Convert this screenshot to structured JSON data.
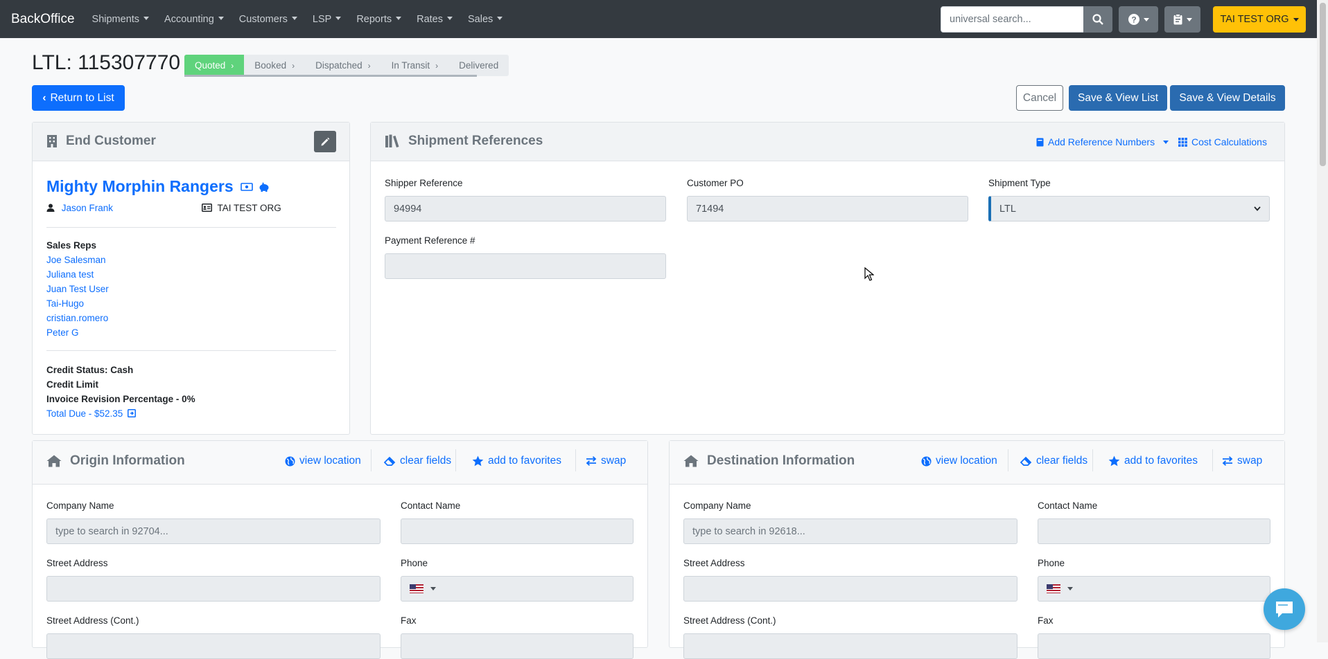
{
  "nav": {
    "brand": "BackOffice",
    "items": [
      "Shipments",
      "Accounting",
      "Customers",
      "LSP",
      "Reports",
      "Rates",
      "Sales"
    ],
    "search_placeholder": "universal search...",
    "org": "TAI TEST ORG"
  },
  "page": {
    "title": "LTL: 115307770",
    "steps": [
      "Quoted",
      "Booked",
      "Dispatched",
      "In Transit",
      "Delivered"
    ],
    "return_label": "Return to List",
    "cancel_label": "Cancel",
    "save_list_label": "Save & View List",
    "save_details_label": "Save & View Details"
  },
  "end_customer": {
    "header": "End Customer",
    "company": "Mighty Morphin Rangers",
    "contact": "Jason Frank",
    "org": "TAI TEST ORG",
    "sales_reps_label": "Sales Reps",
    "sales_reps": [
      "Joe Salesman",
      "Juliana test",
      "Juan Test User",
      "Tai-Hugo",
      "cristian.romero",
      "Peter G"
    ],
    "credit_status": "Credit Status: Cash",
    "credit_limit": "Credit Limit",
    "invoice_revision": "Invoice Revision Percentage - 0%",
    "total_due": "Total Due - $52.35"
  },
  "shipment_refs": {
    "header": "Shipment References",
    "add_ref": "Add Reference Numbers",
    "cost_calc": "Cost Calculations",
    "shipper_ref_label": "Shipper Reference",
    "shipper_ref": "94994",
    "customer_po_label": "Customer PO",
    "customer_po": "71494",
    "shipment_type_label": "Shipment Type",
    "shipment_type": "LTL",
    "payment_ref_label": "Payment Reference #",
    "payment_ref": ""
  },
  "origin": {
    "header": "Origin Information",
    "view_location": "view location",
    "clear_fields": "clear fields",
    "add_favorites": "add to favorites",
    "swap": "swap",
    "company_label": "Company Name",
    "company_placeholder": "type to search in 92704...",
    "contact_label": "Contact Name",
    "street_label": "Street Address",
    "phone_label": "Phone",
    "street2_label": "Street Address (Cont.)",
    "fax_label": "Fax"
  },
  "destination": {
    "header": "Destination Information",
    "view_location": "view location",
    "clear_fields": "clear fields",
    "add_favorites": "add to favorites",
    "swap": "swap",
    "company_label": "Company Name",
    "company_placeholder": "type to search in 92618...",
    "contact_label": "Contact Name",
    "street_label": "Street Address",
    "phone_label": "Phone",
    "street2_label": "Street Address (Cont.)",
    "fax_label": "Fax"
  }
}
